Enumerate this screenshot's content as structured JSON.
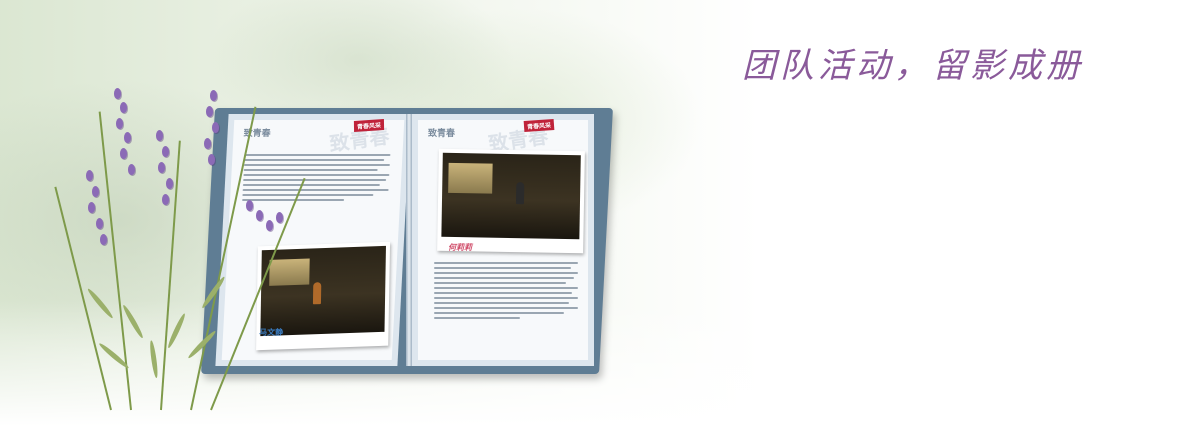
{
  "headline": "团队活动，留影成册",
  "book": {
    "left_page": {
      "title": "致青春",
      "tag": "青春风采",
      "watermark": "致青春",
      "photo_caption": "马文静"
    },
    "right_page": {
      "title": "致青春",
      "tag": "青春风采",
      "watermark": "致青春",
      "photo_caption": "何莉莉"
    }
  },
  "colors": {
    "headline": "#8a5a9a",
    "book_cover": "#5f7d94",
    "tag": "#c0233a",
    "lavender": "#8b6ab6"
  }
}
